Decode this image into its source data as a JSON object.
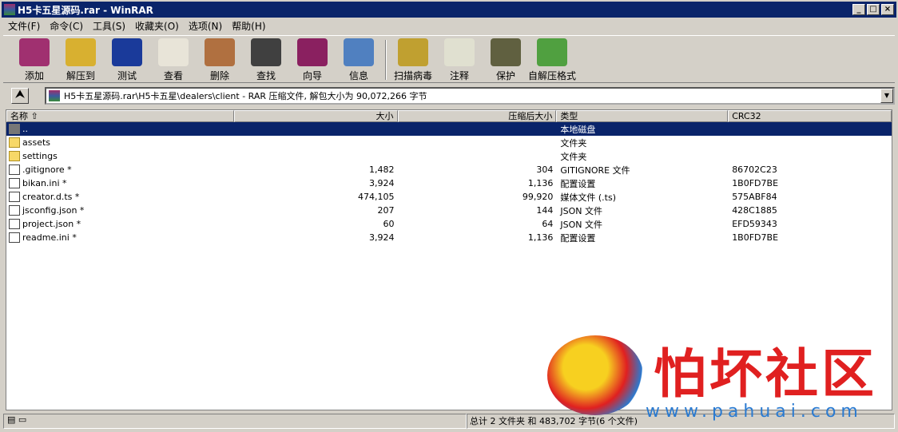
{
  "window": {
    "title": "H5卡五星源码.rar - WinRAR",
    "min": "_",
    "max": "□",
    "close": "×"
  },
  "menu": [
    "文件(F)",
    "命令(C)",
    "工具(S)",
    "收藏夹(O)",
    "选项(N)",
    "帮助(H)"
  ],
  "toolbar": [
    {
      "label": "添加",
      "icon": "archive-add-icon",
      "color": "#a03070"
    },
    {
      "label": "解压到",
      "icon": "extract-folder-icon",
      "color": "#d8b030"
    },
    {
      "label": "测试",
      "icon": "test-book-icon",
      "color": "#1a3a9a"
    },
    {
      "label": "查看",
      "icon": "view-glasses-icon",
      "color": "#e8e4d8"
    },
    {
      "label": "删除",
      "icon": "delete-recycle-icon",
      "color": "#b07040"
    },
    {
      "label": "查找",
      "icon": "find-binoculars-icon",
      "color": "#404040"
    },
    {
      "label": "向导",
      "icon": "wizard-icon",
      "color": "#8a2060"
    },
    {
      "label": "信息",
      "icon": "info-icon",
      "color": "#5080c0"
    },
    {
      "label": "扫描病毒",
      "icon": "virus-scan-icon",
      "color": "#c0a030"
    },
    {
      "label": "注释",
      "icon": "comment-icon",
      "color": "#e0e0d0"
    },
    {
      "label": "保护",
      "icon": "protect-shield-icon",
      "color": "#606040"
    },
    {
      "label": "自解压格式",
      "icon": "sfx-icon",
      "color": "#50a040"
    }
  ],
  "address": {
    "up": "⮝",
    "path": "H5卡五星源码.rar\\H5卡五星\\dealers\\client - RAR 压缩文件, 解包大小为 90,072,266 字节"
  },
  "columns": [
    "名称 ⇧",
    "大小",
    "压缩后大小",
    "类型",
    "CRC32"
  ],
  "files": [
    {
      "name": "..",
      "size": "",
      "packed": "",
      "type": "本地磁盘",
      "crc": "",
      "kind": "updir"
    },
    {
      "name": "assets",
      "size": "",
      "packed": "",
      "type": "文件夹",
      "crc": "",
      "kind": "folder"
    },
    {
      "name": "settings",
      "size": "",
      "packed": "",
      "type": "文件夹",
      "crc": "",
      "kind": "folder"
    },
    {
      "name": ".gitignore *",
      "size": "1,482",
      "packed": "304",
      "type": "GITIGNORE 文件",
      "crc": "86702C23",
      "kind": "doc"
    },
    {
      "name": "bikan.ini *",
      "size": "3,924",
      "packed": "1,136",
      "type": "配置设置",
      "crc": "1B0FD7BE",
      "kind": "doc"
    },
    {
      "name": "creator.d.ts *",
      "size": "474,105",
      "packed": "99,920",
      "type": "媒体文件 (.ts)",
      "crc": "575ABF84",
      "kind": "doc"
    },
    {
      "name": "jsconfig.json *",
      "size": "207",
      "packed": "144",
      "type": "JSON 文件",
      "crc": "428C1885",
      "kind": "doc"
    },
    {
      "name": "project.json *",
      "size": "60",
      "packed": "64",
      "type": "JSON 文件",
      "crc": "EFD59343",
      "kind": "doc"
    },
    {
      "name": "readme.ini *",
      "size": "3,924",
      "packed": "1,136",
      "type": "配置设置",
      "crc": "1B0FD7BE",
      "kind": "doc"
    }
  ],
  "status": {
    "summary": "总计 2 文件夹 和 483,702 字节(6 个文件)"
  },
  "watermark": {
    "text": "怕坏社区",
    "url": "www.pahuai.com"
  }
}
